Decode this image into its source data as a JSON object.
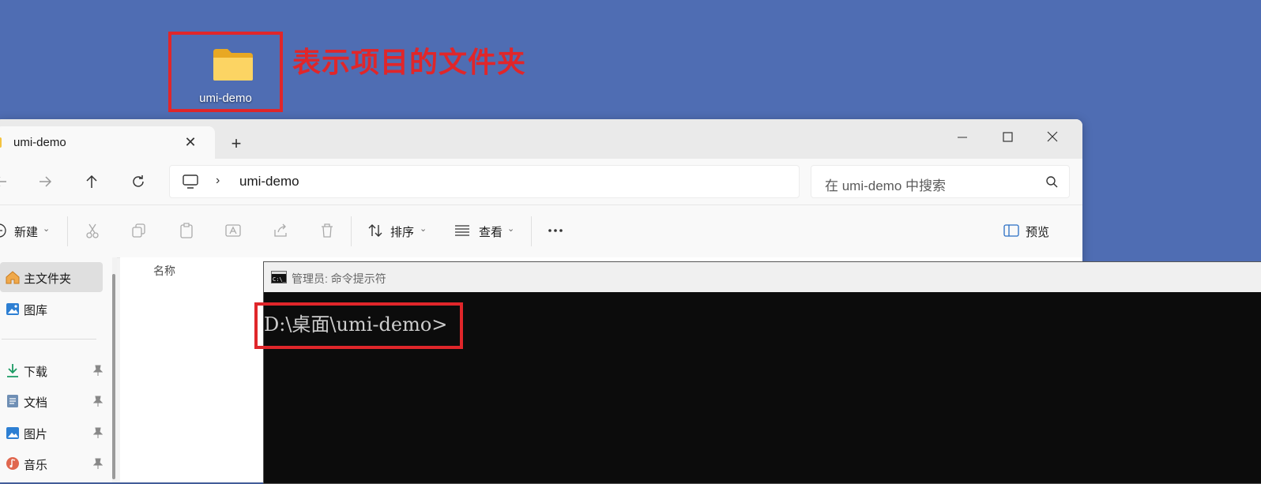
{
  "desktop": {
    "folder_label": "umi-demo",
    "annotation": "表示项目的文件夹",
    "annotation_color": "#e0262a"
  },
  "explorer": {
    "tab_title": "umi-demo",
    "address": {
      "path": "umi-demo"
    },
    "search_placeholder": "在 umi-demo 中搜索",
    "toolbar": {
      "new_label": "新建",
      "sort_label": "排序",
      "view_label": "查看",
      "preview_label": "预览"
    },
    "sidebar": {
      "items": [
        {
          "label": "主文件夹",
          "icon": "home-icon",
          "selected": true
        },
        {
          "label": "图库",
          "icon": "gallery-icon"
        },
        {
          "label": "下载",
          "icon": "download-icon",
          "pinned": true
        },
        {
          "label": "文档",
          "icon": "document-icon",
          "pinned": true
        },
        {
          "label": "图片",
          "icon": "picture-icon",
          "pinned": true
        },
        {
          "label": "音乐",
          "icon": "music-icon",
          "pinned": true
        }
      ]
    },
    "content": {
      "column_name": "名称"
    }
  },
  "cmd": {
    "title": "管理员: 命令提示符",
    "prompt": "D:\\桌面\\umi-demo>"
  }
}
